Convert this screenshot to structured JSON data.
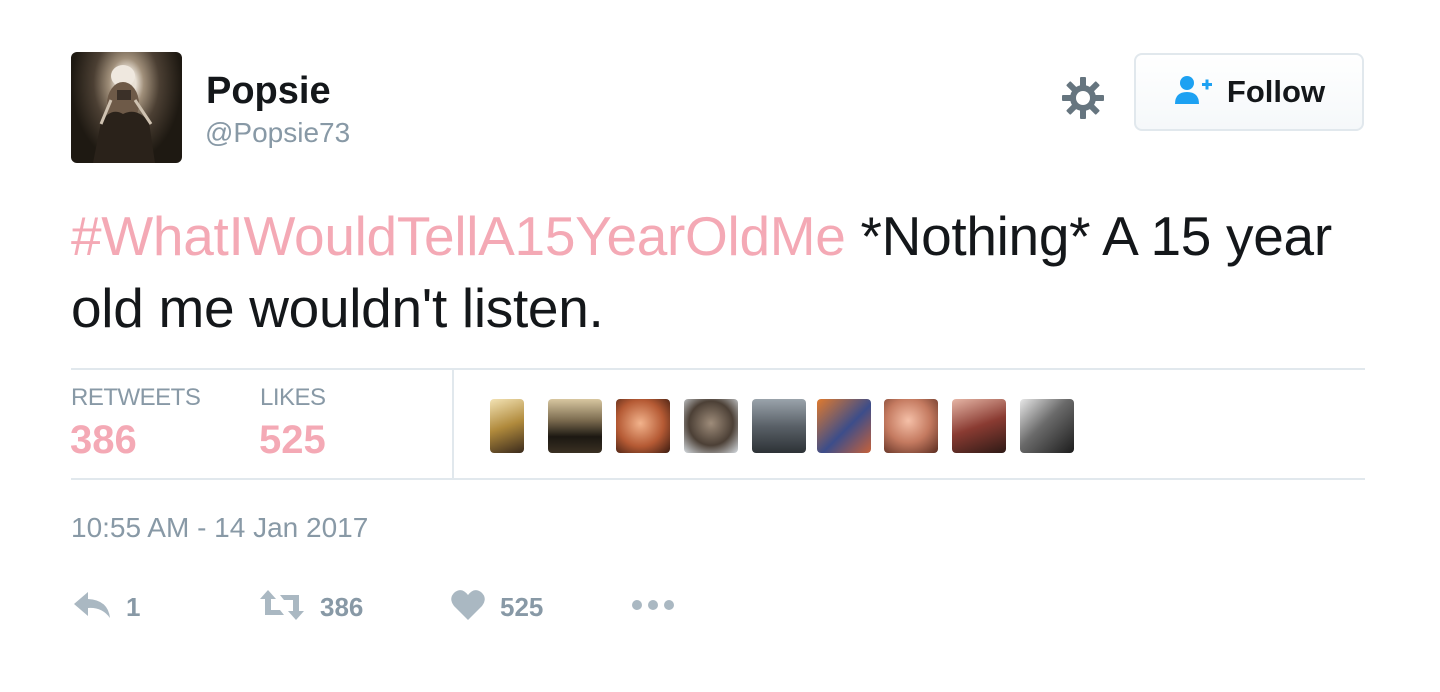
{
  "user": {
    "name": "Popsie",
    "handle": "@Popsie73"
  },
  "follow_button": {
    "label": "Follow"
  },
  "tweet": {
    "hashtag": "#WhatIWouldTellA15YearOldMe",
    "text_after_hashtag": " *Nothing* A 15 year old me wouldn't listen."
  },
  "stats": {
    "retweets_label": "RETWEETS",
    "retweets_value": "386",
    "likes_label": "LIKES",
    "likes_value": "525"
  },
  "timestamp": "10:55 AM - 14 Jan 2017",
  "actions": {
    "reply_count": "1",
    "retweet_count": "386",
    "like_count": "525"
  },
  "colors": {
    "link_pink": "#f4a9b5",
    "muted": "#8899a6",
    "follow_icon": "#1da1f2"
  },
  "icons": [
    "gear-icon",
    "follow-user-icon",
    "reply-icon",
    "retweet-icon",
    "heart-icon",
    "more-icon"
  ]
}
